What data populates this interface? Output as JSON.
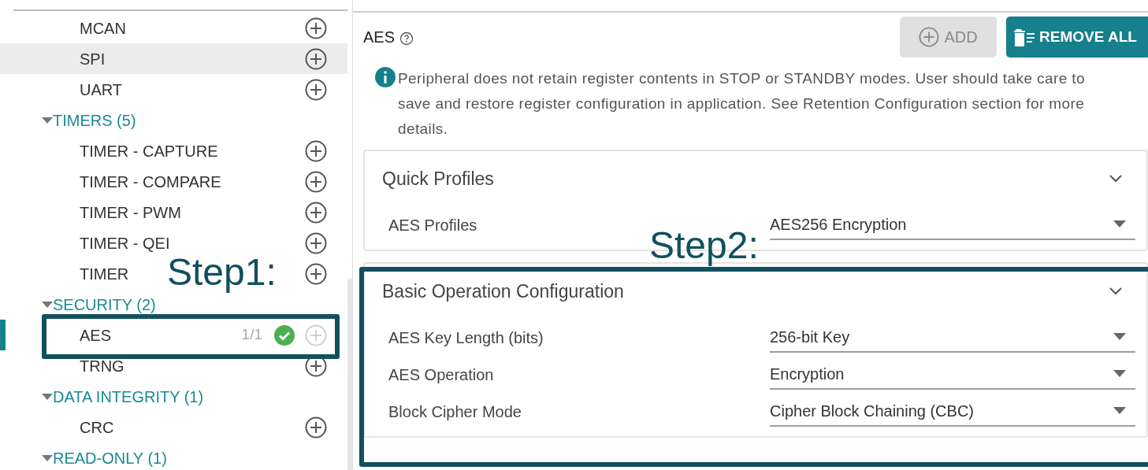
{
  "sidebar": {
    "items": [
      {
        "kind": "item",
        "label": "MCAN",
        "selected": false,
        "highlighted": false,
        "configured": false,
        "add_enabled": true
      },
      {
        "kind": "item",
        "label": "SPI",
        "selected": false,
        "highlighted": true,
        "configured": false,
        "add_enabled": true
      },
      {
        "kind": "item",
        "label": "UART",
        "selected": false,
        "highlighted": false,
        "configured": false,
        "add_enabled": true
      },
      {
        "kind": "group",
        "label": "TIMERS (5)",
        "expanded": true,
        "children": [
          {
            "kind": "item",
            "label": "TIMER - CAPTURE",
            "selected": false,
            "highlighted": false,
            "configured": false,
            "add_enabled": true
          },
          {
            "kind": "item",
            "label": "TIMER - COMPARE",
            "selected": false,
            "highlighted": false,
            "configured": false,
            "add_enabled": true
          },
          {
            "kind": "item",
            "label": "TIMER - PWM",
            "selected": false,
            "highlighted": false,
            "configured": false,
            "add_enabled": true
          },
          {
            "kind": "item",
            "label": "TIMER - QEI",
            "selected": false,
            "highlighted": false,
            "configured": false,
            "add_enabled": true
          },
          {
            "kind": "item",
            "label": "TIMER",
            "selected": false,
            "highlighted": false,
            "configured": false,
            "add_enabled": true
          }
        ]
      },
      {
        "kind": "group",
        "label": "SECURITY (2)",
        "expanded": true,
        "children": [
          {
            "kind": "item",
            "label": "AES",
            "count": "1/1",
            "selected": true,
            "highlighted": false,
            "configured": true,
            "add_enabled": false
          },
          {
            "kind": "item",
            "label": "TRNG",
            "selected": false,
            "highlighted": false,
            "configured": false,
            "add_enabled": true
          }
        ]
      },
      {
        "kind": "group",
        "label": "DATA INTEGRITY (1)",
        "expanded": true,
        "children": [
          {
            "kind": "item",
            "label": "CRC",
            "selected": false,
            "highlighted": false,
            "configured": false,
            "add_enabled": true
          }
        ]
      },
      {
        "kind": "group",
        "label": "READ-ONLY (1)",
        "expanded": true
      }
    ]
  },
  "panel": {
    "title": "AES",
    "buttons": [
      {
        "kind": "add",
        "label": "ADD",
        "disabled": true
      },
      {
        "kind": "remove",
        "label": "REMOVE ALL",
        "disabled": false
      }
    ],
    "info": "Peripheral does not retain register contents in STOP or STANDBY modes. User should take care to save and restore register configuration in application. See Retention Configuration section for more details.",
    "sections": [
      {
        "title": "Quick Profiles",
        "expanded": true,
        "fields": [
          {
            "label": "AES Profiles",
            "value": "AES256 Encryption"
          }
        ]
      },
      {
        "title": "Basic Operation Configuration",
        "expanded": true,
        "fields": [
          {
            "label": "AES Key Length (bits)",
            "value": "256-bit Key"
          },
          {
            "label": "AES Operation",
            "value": "Encryption"
          },
          {
            "label": "Block Cipher Mode",
            "value": "Cipher Block Chaining (CBC)"
          }
        ]
      }
    ]
  },
  "annotations": [
    {
      "label": "Step1:"
    },
    {
      "label": "Step2:"
    }
  ]
}
